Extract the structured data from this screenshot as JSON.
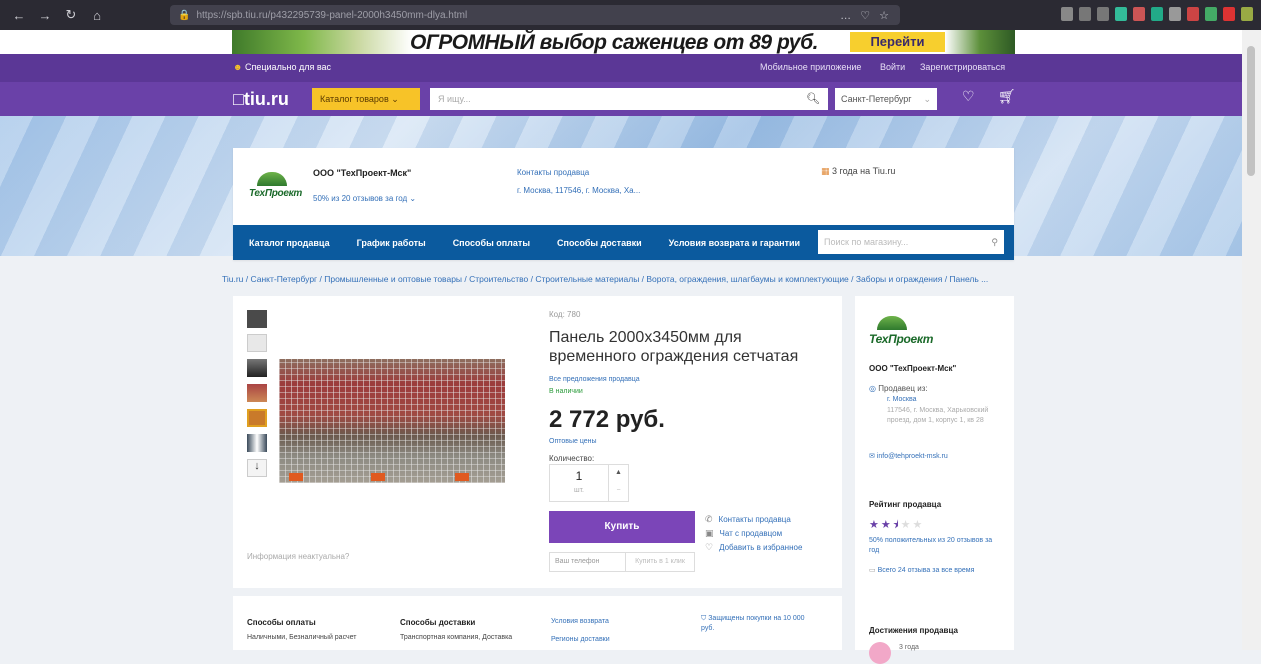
{
  "browser": {
    "url": "https://spb.tiu.ru/p432295739-panel-2000h3450mm-dlya.html",
    "menu_dots": "… ♡ ☆"
  },
  "banner": {
    "text": "ОГРОМНЫЙ выбор саженцев от 89 руб.",
    "button": "Перейти"
  },
  "topbar": {
    "special": "Специально для вас",
    "mobile_app": "Мобильное приложение",
    "login": "Войти",
    "register": "Зарегистрироваться"
  },
  "header": {
    "logo": "□tiu.ru",
    "catalog": "Каталог товаров",
    "search_placeholder": "Я ищу...",
    "city": "Санкт-Петербург"
  },
  "seller": {
    "logo_text": "ТехПроект",
    "name": "ООО \"ТехПроект-Мск\"",
    "reviews": "50% из 20 отзывов за год",
    "contacts": "Контакты продавца",
    "address_short": "г. Москва, 117546, г. Москва, Ха...",
    "years": "3 года на Tiu.ru",
    "nav": [
      "Каталог продавца",
      "График работы",
      "Способы оплаты",
      "Способы доставки",
      "Условия возврата и гарантии"
    ],
    "shop_search_placeholder": "Поиск по магазину..."
  },
  "breadcrumb": "Tiu.ru / Санкт-Петербург / Промышленные и оптовые товары / Строительство / Строительные материалы / Ворота, ограждения, шлагбаумы и комплектующие / Заборы и ограждения / Панель ...",
  "product": {
    "code": "Код: 780",
    "title": "Панель 2000х3450мм для временного ограждения сетчатая",
    "all_offers": "Все предложения продавца",
    "in_stock": "В наличии",
    "price": "2 772 руб.",
    "wholesale": "Оптовые цены",
    "qty_label": "Количество:",
    "qty": "1",
    "qty_unit": "шт.",
    "buy": "Купить",
    "phone_placeholder": "Ваш телефон",
    "one_click": "Купить в 1 клик",
    "actions": [
      "Контакты продавца",
      "Чат с продавцом",
      "Добавить в избранное"
    ],
    "incorrect_info": "Информация неактуальна?"
  },
  "side": {
    "name": "ООО \"ТехПроект-Мск\"",
    "seller_from": "Продавец из:",
    "city": "г. Москва",
    "address": "117546, г. Москва, Харьковский проезд, дом 1, корпус 1, кв 28",
    "email": "info@tehproekt-msk.ru",
    "rating_title": "Рейтинг продавца",
    "rating": 2.5,
    "rating_text": "50% положительных из 20 отзывов за год",
    "all_reviews": "Всего 24 отзыва за все время",
    "achievements": "Достижения продавца",
    "achievement_item": "3 года"
  },
  "bottom": {
    "payment_title": "Способы оплаты",
    "payment_text": "Наличными, Безналичный расчет",
    "delivery_title": "Способы доставки",
    "delivery_text": "Транспортная компания, Доставка",
    "return": "Условия возврата",
    "regions": "Регионы доставки",
    "protected": "Защищены покупки на 10 000 руб."
  },
  "colors": {
    "purple": "#6a41a8",
    "blue_nav": "#0b5a9e",
    "buy": "#7b45b8",
    "yellow": "#f7c328"
  }
}
